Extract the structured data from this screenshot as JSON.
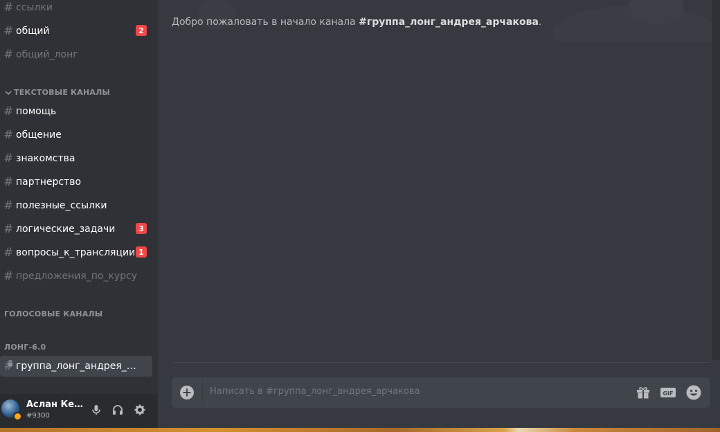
{
  "sidebar": {
    "channels_top": [
      {
        "name": "ссылки",
        "state": "muted"
      },
      {
        "name": "общий",
        "state": "unread",
        "badge": "2"
      },
      {
        "name": "общий_лонг",
        "state": "muted"
      }
    ],
    "text_category": "ТЕКСТОВЫЕ КАНАЛЫ",
    "text_channels": [
      {
        "name": "помощь",
        "state": "unread"
      },
      {
        "name": "общение",
        "state": "unread"
      },
      {
        "name": "знакомства",
        "state": "unread"
      },
      {
        "name": "партнерство",
        "state": "unread"
      },
      {
        "name": "полезные_ссылки",
        "state": "unread"
      },
      {
        "name": "логические_задачи",
        "state": "unread",
        "badge": "3"
      },
      {
        "name": "вопросы_к_трансляции",
        "state": "unread",
        "badge": "1"
      },
      {
        "name": "предложения_по_курсу",
        "state": "muted"
      }
    ],
    "voice_category": "ГОЛОСОВЫЕ КАНАЛЫ",
    "long_category": "ЛОНГ-6.0",
    "selected_channel": "группа_лонг_андрея_ар..."
  },
  "user": {
    "name": "Аслан Кери...",
    "tag": "#9300",
    "status_color": "#faa61a"
  },
  "main": {
    "welcome_prefix": "Добро пожаловать в начало канала ",
    "channel_name": "#группа_лонг_андрея_арчакова",
    "welcome_suffix": "."
  },
  "composer": {
    "placeholder": "Написать в #группа_лонг_андрея_арчакова"
  },
  "colors": {
    "accent_badge": "#f04747",
    "background": "#36393f",
    "sidebar": "#2f3136"
  }
}
